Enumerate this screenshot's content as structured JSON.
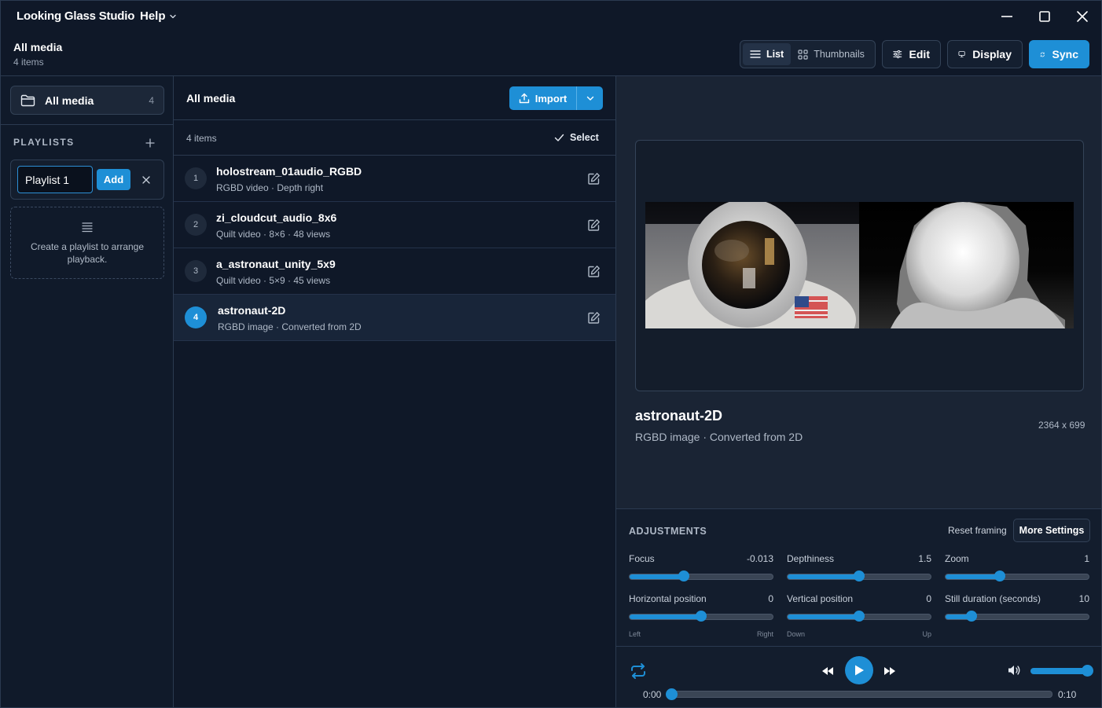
{
  "app": {
    "title": "Looking Glass Studio",
    "help_menu": "Help"
  },
  "header": {
    "title": "All media",
    "count": "4 items",
    "view_toggle": {
      "list": "List",
      "thumbnails": "Thumbnails",
      "active": "list"
    },
    "edit": "Edit",
    "display": "Display",
    "sync": "Sync"
  },
  "sidebar": {
    "all_media": {
      "label": "All media",
      "count": "4"
    },
    "playlists_heading": "PLAYLISTS",
    "new_playlist": {
      "value": "Playlist 1",
      "add": "Add"
    },
    "empty_text": "Create a playlist to arrange playback."
  },
  "media": {
    "title": "All media",
    "import": "Import",
    "count": "4 items",
    "select": "Select",
    "items": [
      {
        "num": "1",
        "title": "holostream_01audio_RGBD",
        "subtitle": "RGBD video · Depth right",
        "selected": false
      },
      {
        "num": "2",
        "title": "zi_cloudcut_audio_8x6",
        "subtitle": "Quilt video · 8×6 · 48 views",
        "selected": false
      },
      {
        "num": "3",
        "title": "a_astronaut_unity_5x9",
        "subtitle": "Quilt video · 5×9 · 45 views",
        "selected": false
      },
      {
        "num": "4",
        "title": "astronaut-2D",
        "subtitle": "RGBD image · Converted from 2D",
        "selected": true
      }
    ]
  },
  "preview": {
    "title": "astronaut-2D",
    "subtitle": "RGBD image · Converted from 2D",
    "dimensions": "2364 x 699"
  },
  "adjustments": {
    "heading": "ADJUSTMENTS",
    "reset": "Reset framing",
    "more_settings": "More Settings",
    "sliders": [
      {
        "label": "Focus",
        "value": "-0.013",
        "fraction": 0.38,
        "min_label": "",
        "max_label": ""
      },
      {
        "label": "Depthiness",
        "value": "1.5",
        "fraction": 0.5,
        "min_label": "",
        "max_label": ""
      },
      {
        "label": "Zoom",
        "value": "1",
        "fraction": 0.38,
        "min_label": "",
        "max_label": ""
      },
      {
        "label": "Horizontal position",
        "value": "0",
        "fraction": 0.5,
        "min_label": "Left",
        "max_label": "Right"
      },
      {
        "label": "Vertical position",
        "value": "0",
        "fraction": 0.5,
        "min_label": "Down",
        "max_label": "Up"
      },
      {
        "label": "Still duration (seconds)",
        "value": "10",
        "fraction": 0.18,
        "min_label": "",
        "max_label": ""
      }
    ]
  },
  "player": {
    "time_current": "0:00",
    "time_total": "0:10",
    "progress": 0,
    "volume": 1
  },
  "colors": {
    "accent": "#1e8fd6",
    "background": "#0f1828",
    "panel": "#1a2434"
  }
}
